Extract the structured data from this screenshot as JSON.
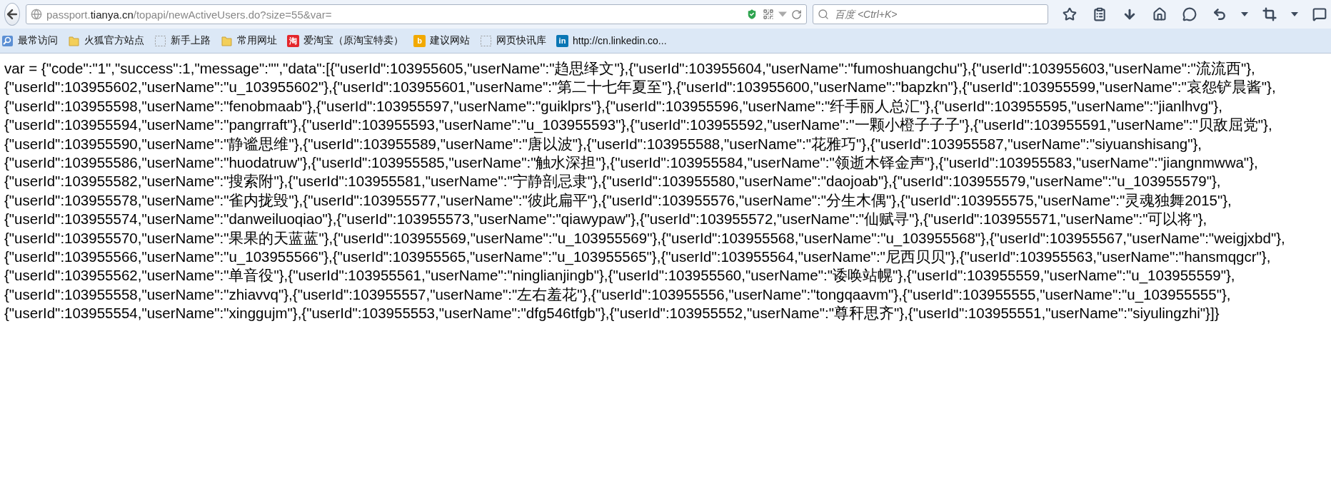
{
  "address_bar": {
    "url_prefix": "passport.",
    "url_domain": "tianya.cn",
    "url_path": "/topapi/newActiveUsers.do?size=55&var="
  },
  "search": {
    "placeholder": "百度 <Ctrl+K>"
  },
  "bookmarks": [
    {
      "kind": "feed",
      "label": "最常访问"
    },
    {
      "kind": "folder",
      "label": "火狐官方站点"
    },
    {
      "kind": "page",
      "label": "新手上路"
    },
    {
      "kind": "folder",
      "label": "常用网址"
    },
    {
      "kind": "taobao",
      "logo_text": "淘",
      "label": "爱淘宝（原淘宝特卖）"
    },
    {
      "kind": "bing",
      "logo_text": "b",
      "label": "建议网站"
    },
    {
      "kind": "page",
      "label": "网页快讯库"
    },
    {
      "kind": "linkedin",
      "logo_text": "in",
      "label": "http://cn.linkedin.co..."
    }
  ],
  "content_lines": [
    "var = {\"code\":\"1\",\"success\":1,\"message\":\"\",\"data\":[{\"userId\":103955605,\"userName\":\"趋思绎文\"},{\"userId\":103955604,\"userName\":\"fumoshuangchu\"},{\"userId\":103955603,\"userName\":\"流流西\"},",
    "{\"userId\":103955602,\"userName\":\"u_103955602\"},{\"userId\":103955601,\"userName\":\"第二十七年夏至\"},{\"userId\":103955600,\"userName\":\"bapzkn\"},{\"userId\":103955599,\"userName\":\"哀怨铲晨酱\"},",
    "{\"userId\":103955598,\"userName\":\"fenobmaab\"},{\"userId\":103955597,\"userName\":\"guiklprs\"},{\"userId\":103955596,\"userName\":\"纤手丽人总汇\"},{\"userId\":103955595,\"userName\":\"jianlhvg\"},",
    "{\"userId\":103955594,\"userName\":\"pangrraft\"},{\"userId\":103955593,\"userName\":\"u_103955593\"},{\"userId\":103955592,\"userName\":\"一颗小橙子子子\"},{\"userId\":103955591,\"userName\":\"贝敌屈党\"},",
    "{\"userId\":103955590,\"userName\":\"静谧思维\"},{\"userId\":103955589,\"userName\":\"唐以波\"},{\"userId\":103955588,\"userName\":\"花雅巧\"},{\"userId\":103955587,\"userName\":\"siyuanshisang\"},",
    "{\"userId\":103955586,\"userName\":\"huodatruw\"},{\"userId\":103955585,\"userName\":\"触水深担\"},{\"userId\":103955584,\"userName\":\"领逝木铎金声\"},{\"userId\":103955583,\"userName\":\"jiangnmwwa\"},",
    "{\"userId\":103955582,\"userName\":\"搜索附\"},{\"userId\":103955581,\"userName\":\"宁静剖忌隶\"},{\"userId\":103955580,\"userName\":\"daojoab\"},{\"userId\":103955579,\"userName\":\"u_103955579\"},",
    "{\"userId\":103955578,\"userName\":\"雀内拢毁\"},{\"userId\":103955577,\"userName\":\"彼此扁平\"},{\"userId\":103955576,\"userName\":\"分生木偶\"},{\"userId\":103955575,\"userName\":\"灵魂独舞2015\"},",
    "{\"userId\":103955574,\"userName\":\"danweiluoqiao\"},{\"userId\":103955573,\"userName\":\"qiawypaw\"},{\"userId\":103955572,\"userName\":\"仙赋寻\"},{\"userId\":103955571,\"userName\":\"可以将\"},",
    "{\"userId\":103955570,\"userName\":\"果果的天蓝蓝\"},{\"userId\":103955569,\"userName\":\"u_103955569\"},{\"userId\":103955568,\"userName\":\"u_103955568\"},{\"userId\":103955567,\"userName\":\"weigjxbd\"},",
    "{\"userId\":103955566,\"userName\":\"u_103955566\"},{\"userId\":103955565,\"userName\":\"u_103955565\"},{\"userId\":103955564,\"userName\":\"尼西贝贝\"},{\"userId\":103955563,\"userName\":\"hansmqgcr\"},",
    "{\"userId\":103955562,\"userName\":\"单音役\"},{\"userId\":103955561,\"userName\":\"ninglianjingb\"},{\"userId\":103955560,\"userName\":\"诿唤站幌\"},{\"userId\":103955559,\"userName\":\"u_103955559\"},",
    "{\"userId\":103955558,\"userName\":\"zhiavvq\"},{\"userId\":103955557,\"userName\":\"左右羞花\"},{\"userId\":103955556,\"userName\":\"tongqaavm\"},{\"userId\":103955555,\"userName\":\"u_103955555\"},",
    "{\"userId\":103955554,\"userName\":\"xinggujm\"},{\"userId\":103955553,\"userName\":\"dfg546tfgb\"},{\"userId\":103955552,\"userName\":\"尊秆思齐\"},{\"userId\":103955551,\"userName\":\"siyulingzhi\"}]}"
  ]
}
